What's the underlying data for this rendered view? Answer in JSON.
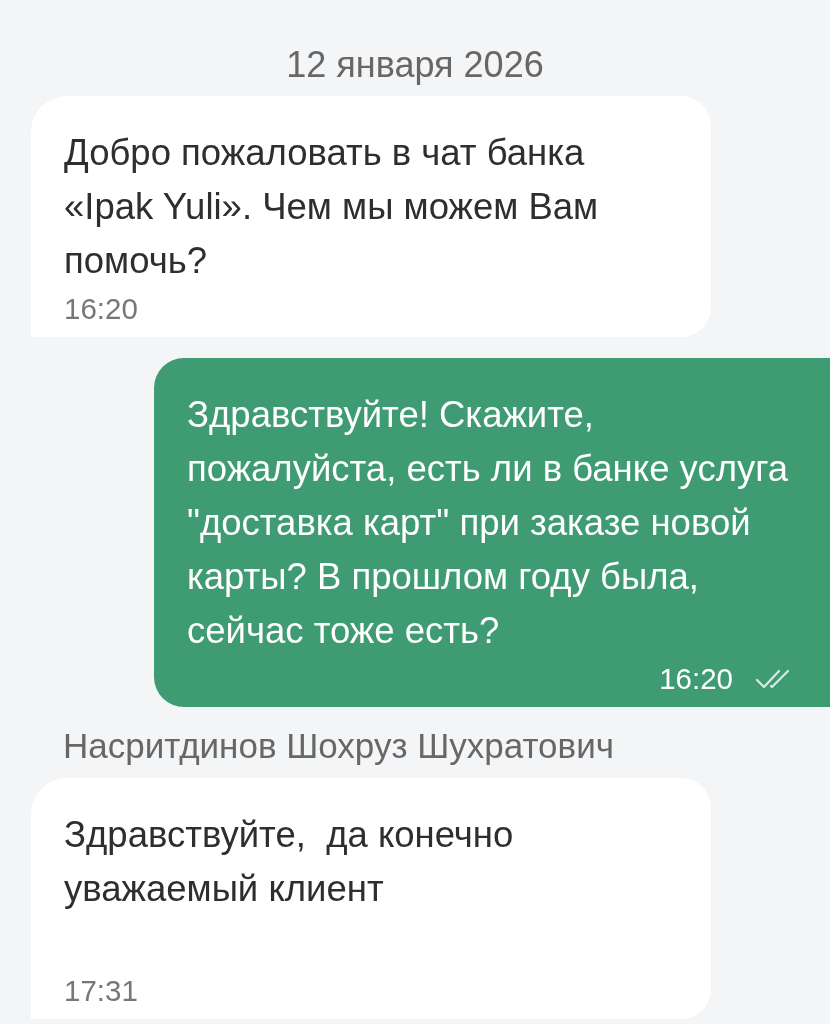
{
  "chat": {
    "date_separator": "12 января 2026",
    "messages": [
      {
        "kind": "incoming",
        "text": "Добро пожаловать в чат банка «Ipak Yuli». Чем мы можем Вам помочь?",
        "time": "16:20"
      },
      {
        "kind": "outgoing",
        "text": "Здравствуйте! Скажите, пожалуйста, есть ли в банке услуга \"доставка карт\" при заказе новой карты? В прошлом году была, сейчас тоже есть?",
        "time": "16:20",
        "read": true
      },
      {
        "kind": "incoming",
        "sender": "Насритдинов Шохруз Шухратович",
        "text": "Здравствуйте,  да конечно уважаемый клиент\n",
        "time": "17:31"
      }
    ]
  }
}
